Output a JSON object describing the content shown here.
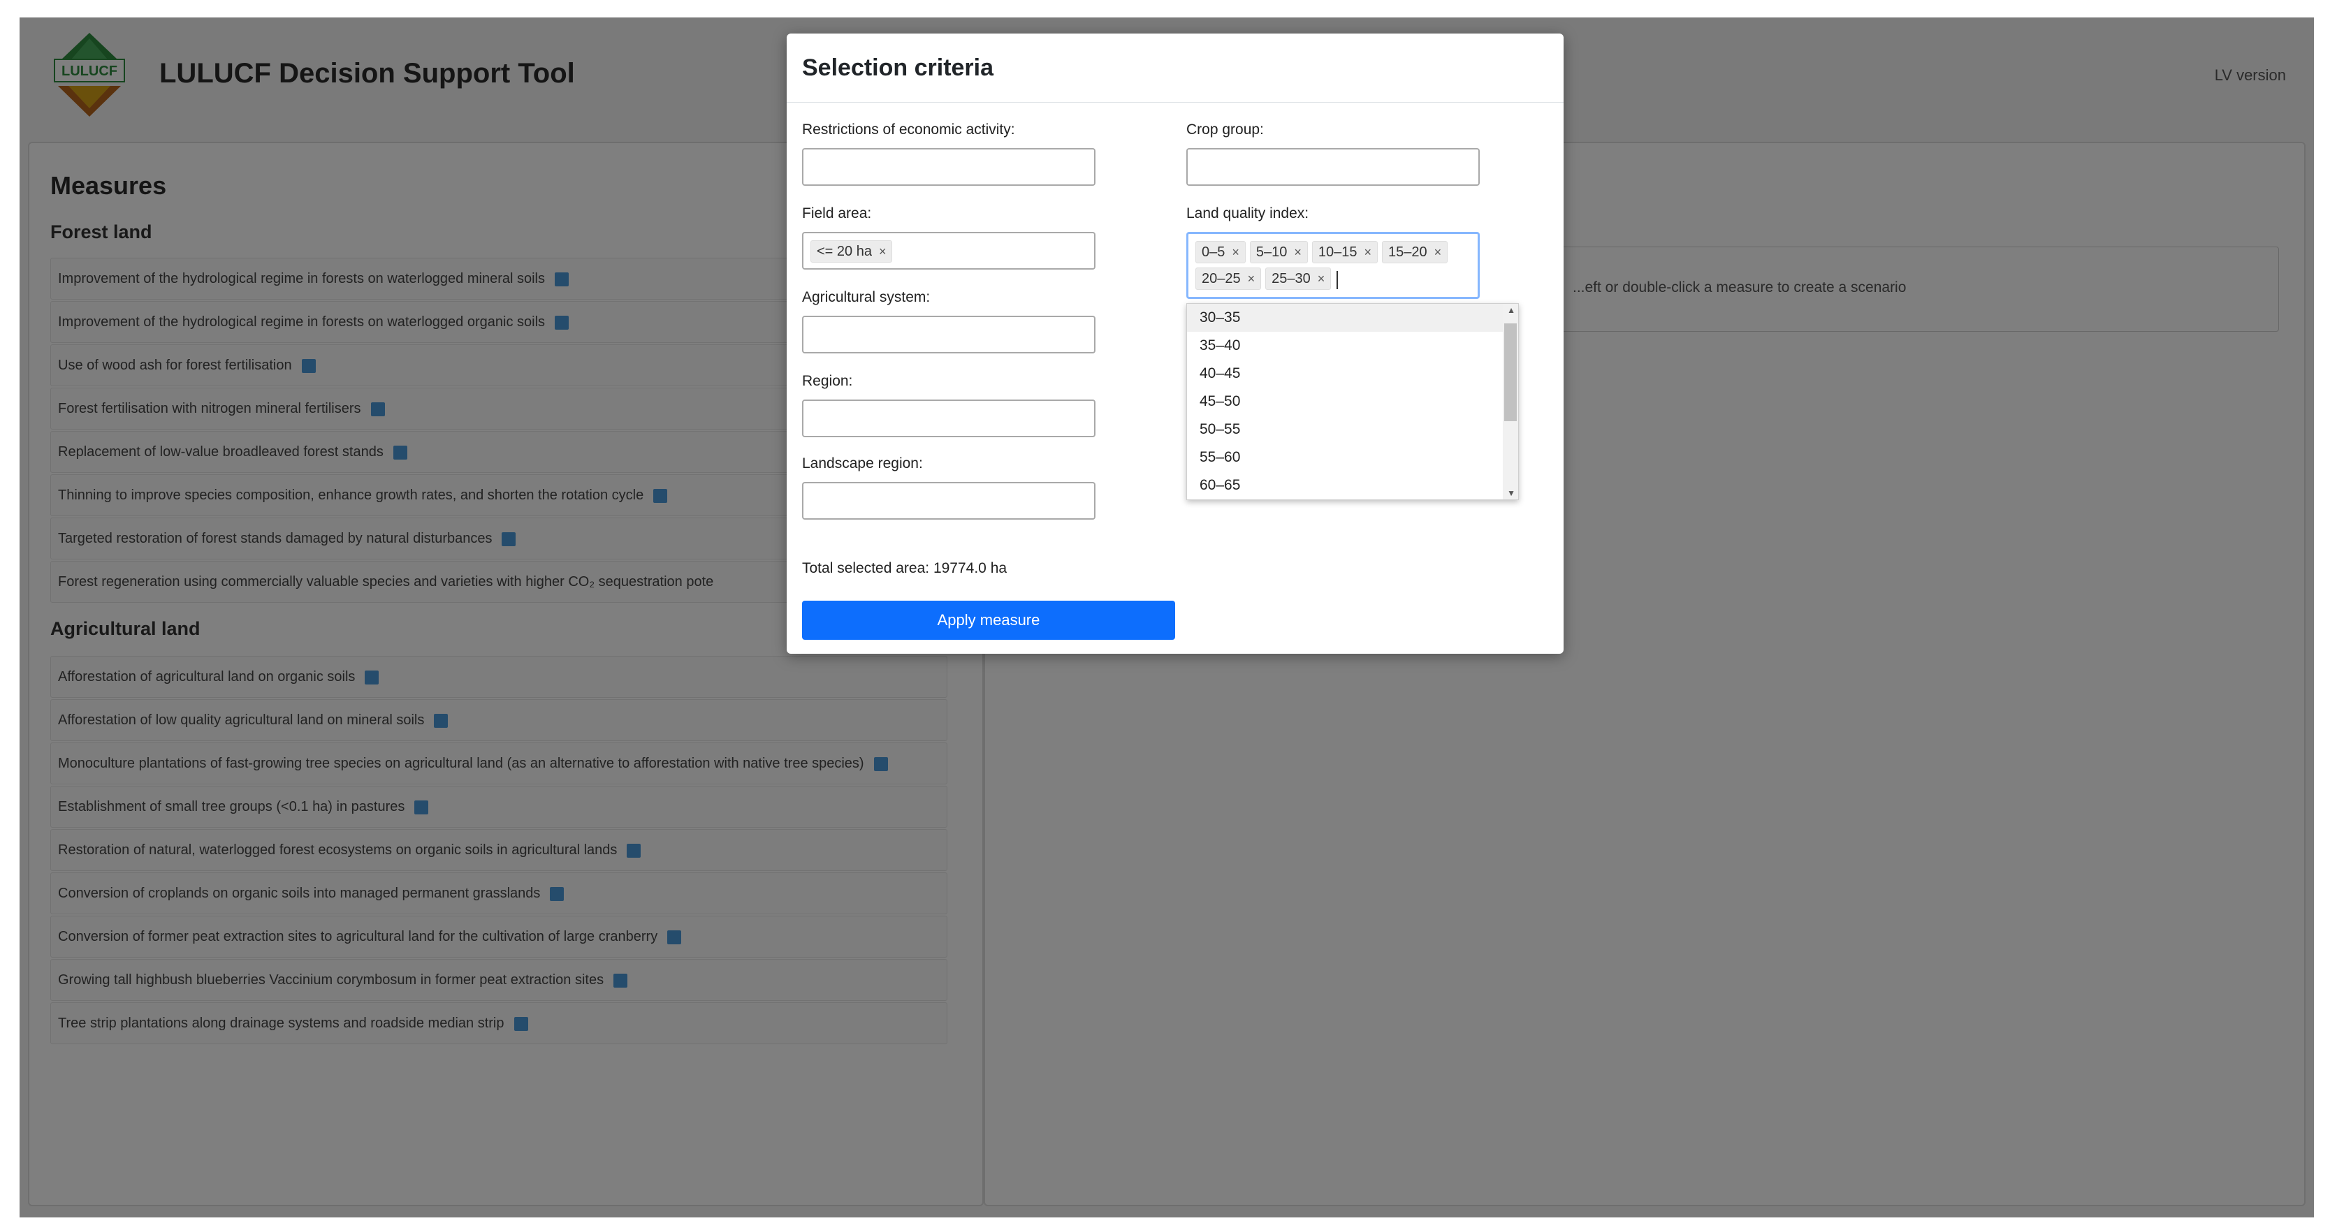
{
  "header": {
    "title": "LULUCF Decision Support Tool",
    "logo_text": "LULUCF",
    "lang_link": "LV version"
  },
  "measures": {
    "title": "Measures",
    "forest": {
      "title": "Forest land",
      "items": [
        "Improvement of the hydrological regime in forests on waterlogged mineral soils",
        "Improvement of the hydrological regime in forests on waterlogged organic soils",
        "Use of wood ash for forest fertilisation",
        "Forest fertilisation with nitrogen mineral fertilisers",
        "Replacement of low-value broadleaved forest stands",
        "Thinning to improve species composition, enhance growth rates, and shorten the rotation cycle",
        "Targeted restoration of forest stands damaged by natural disturbances",
        "Forest regeneration using commercially valuable species and varieties with higher CO₂ sequestration pote"
      ]
    },
    "agri": {
      "title": "Agricultural land",
      "items": [
        "Afforestation of agricultural land on organic soils",
        "Afforestation of low quality agricultural land on mineral soils",
        "Monoculture plantations of fast-growing tree species on agricultural land (as an alternative to afforestation with native tree species)",
        "Establishment of small tree groups (<0.1 ha) in pastures",
        "Restoration of natural, waterlogged forest ecosystems on organic soils in agricultural lands",
        "Conversion of croplands on organic soils into managed permanent grasslands",
        "Conversion of former peat extraction sites to agricultural land for the cultivation of large cranberry",
        "Growing tall highbush blueberries Vaccinium corymbosum in former peat extraction sites",
        "Tree strip plantations along drainage systems and roadside median strip"
      ]
    }
  },
  "right_panel": {
    "hint": "...eft or double-click a measure to create a scenario"
  },
  "modal": {
    "title": "Selection criteria",
    "labels": {
      "restrictions": "Restrictions of economic activity:",
      "crop_group": "Crop group:",
      "field_area": "Field area:",
      "land_quality": "Land quality index:",
      "agri_system": "Agricultural system:",
      "region": "Region:",
      "landscape_region": "Landscape region:"
    },
    "field_area_tags": [
      "<= 20 ha"
    ],
    "land_quality_tags": [
      "0–5",
      "5–10",
      "10–15",
      "15–20",
      "20–25",
      "25–30"
    ],
    "tag_remove": "×",
    "dropdown_options": [
      "30–35",
      "35–40",
      "40–45",
      "45–50",
      "50–55",
      "55–60",
      "60–65"
    ],
    "total_area": "Total selected area: 19774.0 ha",
    "apply_label": "Apply measure"
  },
  "colors": {
    "primary": "#0d6efd",
    "info_icon": "#4a98d8",
    "focus_border": "#86b7fe"
  }
}
